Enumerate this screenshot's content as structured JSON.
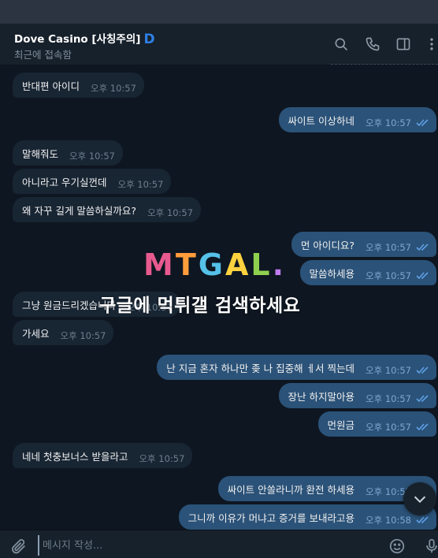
{
  "header": {
    "title": "Dove Casino [사칭주의]",
    "badge": "D",
    "status": "최근에 접속함"
  },
  "messages": [
    {
      "dir": "in",
      "text": "반대편 아이디",
      "time": "오후 10:57"
    },
    {
      "dir": "out",
      "text": "싸이트 이상하네",
      "time": "오후 10:57"
    },
    {
      "dir": "in",
      "text": "말해줘도",
      "time": "오후 10:57"
    },
    {
      "dir": "in",
      "text": "아니라고 우기실껀데",
      "time": "오후 10:57"
    },
    {
      "dir": "in",
      "text": "왜 자꾸 길게 말씀하실까요?",
      "time": "오후 10:57"
    },
    {
      "dir": "out",
      "text": "먼 아이디요?",
      "time": "오후 10:57"
    },
    {
      "dir": "out",
      "text": "말씀하세용",
      "time": "오후 10:57"
    },
    {
      "dir": "in",
      "text": "그냥 원금드리겠습니다",
      "time": "오후 10:57"
    },
    {
      "dir": "in",
      "text": "가세요",
      "time": "오후 10:57"
    },
    {
      "dir": "out",
      "text": "난 지금 혼자 하나만 좆 나  집중해 ㅔ서 찍는데",
      "time": "오후 10:57"
    },
    {
      "dir": "out",
      "text": "장난 하지말아용",
      "time": "오후 10:57"
    },
    {
      "dir": "out",
      "text": "먼원금",
      "time": "오후 10:57"
    },
    {
      "dir": "in",
      "text": "네네 첫충보너스 받을라고",
      "time": "오후 10:57"
    },
    {
      "dir": "out",
      "text": "싸이트  안쏠라니까 환전 하세용",
      "time": "오후 10:57"
    },
    {
      "dir": "out",
      "text": "그니까 이유가 머냐고 증거를 보내라고용",
      "time": "오후 10:58"
    }
  ],
  "watermark": {
    "logo_letters": [
      "M",
      "T",
      "G",
      "A",
      "L",
      "."
    ],
    "text": "구글에 먹튀갤 검색하세요"
  },
  "composer": {
    "placeholder": "메시지 작성..."
  },
  "icons": {
    "search": "search-icon",
    "call": "phone-icon",
    "sidebar": "sidebar-toggle-icon",
    "more": "more-vertical-icon",
    "attach": "paperclip-icon",
    "emoji": "emoji-icon",
    "mic": "microphone-icon",
    "scroll": "chevron-down-icon",
    "read": "double-check-icon"
  },
  "colors": {
    "background": "#0e1621",
    "header": "#17212b",
    "incoming_bubble": "#182533",
    "outgoing_bubble": "#2b5278",
    "accent": "#2f7fe6",
    "read_check": "#5ea0e6"
  }
}
